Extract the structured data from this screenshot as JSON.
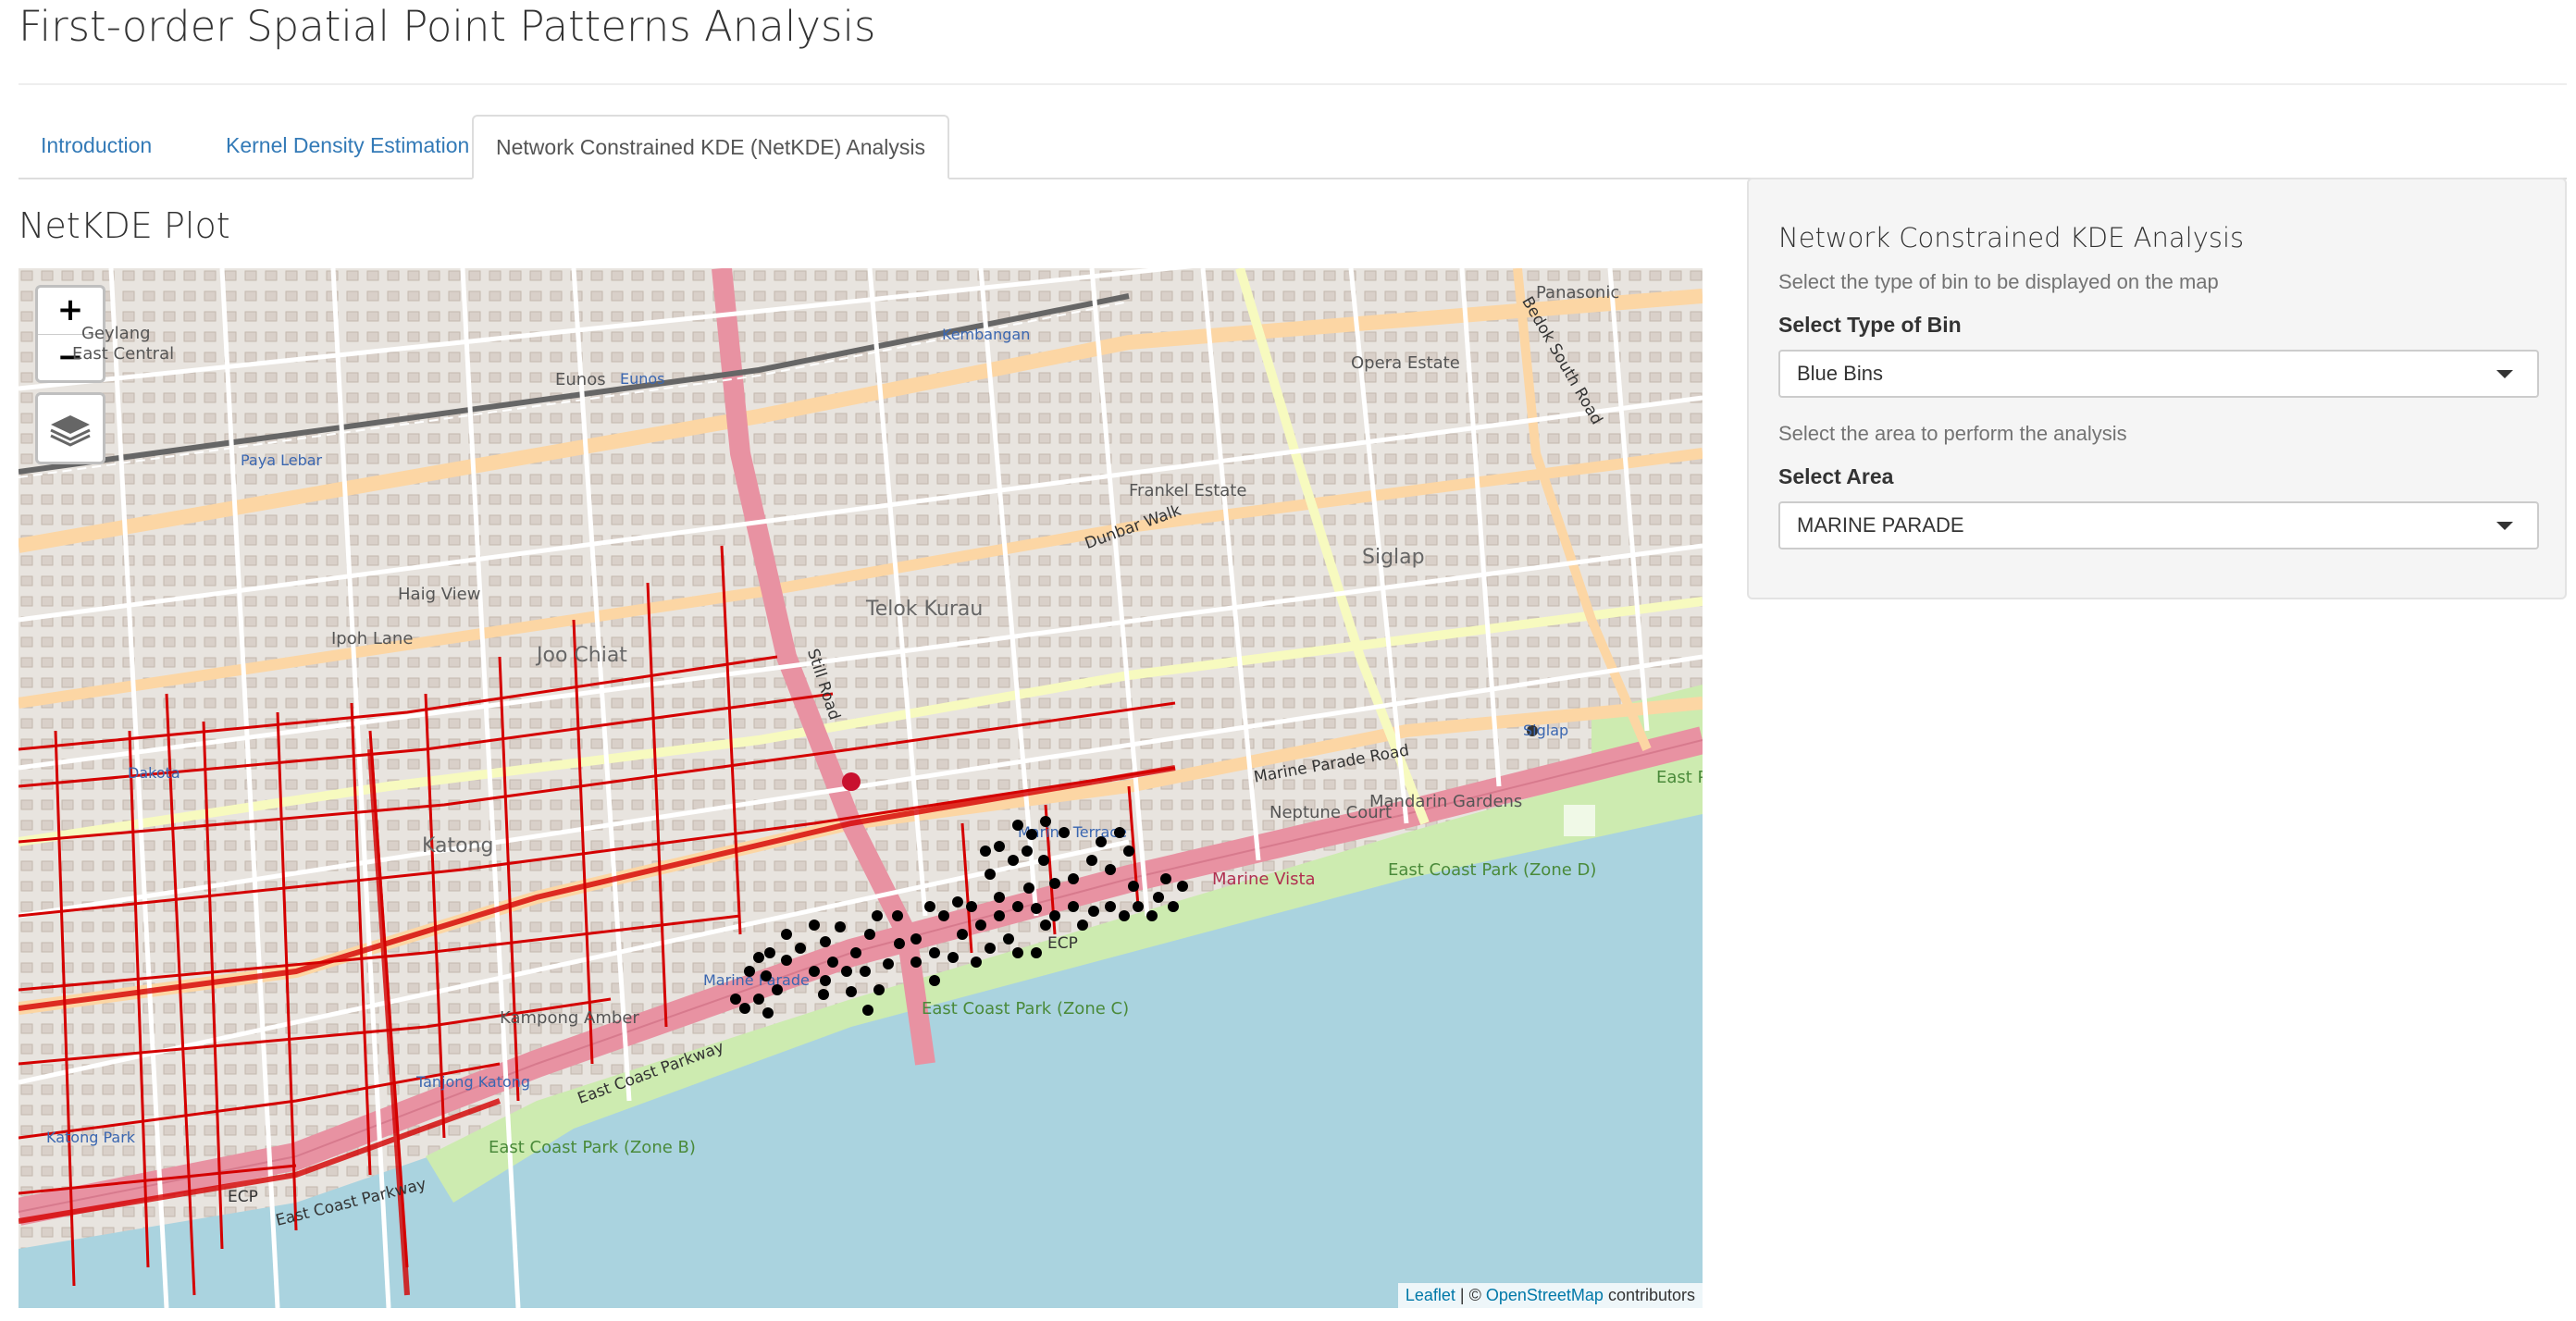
{
  "page": {
    "title": "First-order Spatial Point Patterns Analysis"
  },
  "tabs": [
    {
      "label": "Introduction",
      "active": false
    },
    {
      "label": "Kernel Density Estimation",
      "active": false
    },
    {
      "label": "Network Constrained KDE (NetKDE) Analysis",
      "active": true
    }
  ],
  "main": {
    "heading": "NetKDE Plot"
  },
  "map": {
    "zoom_in": "+",
    "zoom_out": "−",
    "attribution": {
      "leaflet": "Leaflet",
      "separator": " | © ",
      "osm": "OpenStreetMap",
      "suffix": " contributors"
    },
    "place_labels": {
      "eunos": "Eunos",
      "eunos_station": "Eunos",
      "kembangan": "Kembangan",
      "paya_lebar": "Paya Lebar",
      "geylang": "Geylang",
      "east_central": "East Central",
      "siglap": "Siglap",
      "siglap_station": "Siglap",
      "opera_estate": "Opera Estate",
      "frankel_estate": "Frankel Estate",
      "telok_kurau": "Telok Kurau",
      "joo_chiat": "Joo Chiat",
      "katong": "Katong",
      "dakota": "Dakota",
      "katong_park": "Katong Park",
      "kampong_amber": "Kampong Amber",
      "tanjong_katong": "Tanjong Katong",
      "marine_parade": "Marine Parade",
      "marine_terrace": "Marine Terrace",
      "marine_vista": "Marine Vista",
      "east_coast_park_b": "East Coast Park (Zone B)",
      "east_coast_park_c": "East Coast Park (Zone C)",
      "east_coast_park_d": "East Coast Park (Zone D)",
      "east_park": "East Park",
      "neptune_court": "Neptune Court",
      "mandarin_gardens": "Mandarin Gardens",
      "panasonic": "Panasonic",
      "haig_view": "Haig View",
      "ipoh_lane": "Ipoh Lane"
    },
    "road_labels": {
      "marine_parade_road": "Marine Parade Road",
      "east_coast_parkway": "East Coast Parkway",
      "east_coast_parkway_2": "East Coast Parkway",
      "bedok_south_road": "Bedok South Road",
      "still_road": "Still Road",
      "ecp": "ECP",
      "ecp_2": "ECP",
      "dunbar_walk": "Dunbar Walk"
    }
  },
  "sidebar": {
    "title": "Network Constrained KDE Analysis",
    "bin_help": "Select the type of bin to be displayed on the map",
    "bin_label": "Select Type of Bin",
    "bin_value": "Blue Bins",
    "area_help": "Select the area to perform the analysis",
    "area_label": "Select Area",
    "area_value": "MARINE PARADE"
  },
  "colors": {
    "link": "#337ab7",
    "sea": "#aad3df",
    "park": "#c8e6b4",
    "network": "#d40000",
    "bin_point": "#000000",
    "expressway": "#e892a2",
    "primary_road": "#fcd6a4"
  }
}
